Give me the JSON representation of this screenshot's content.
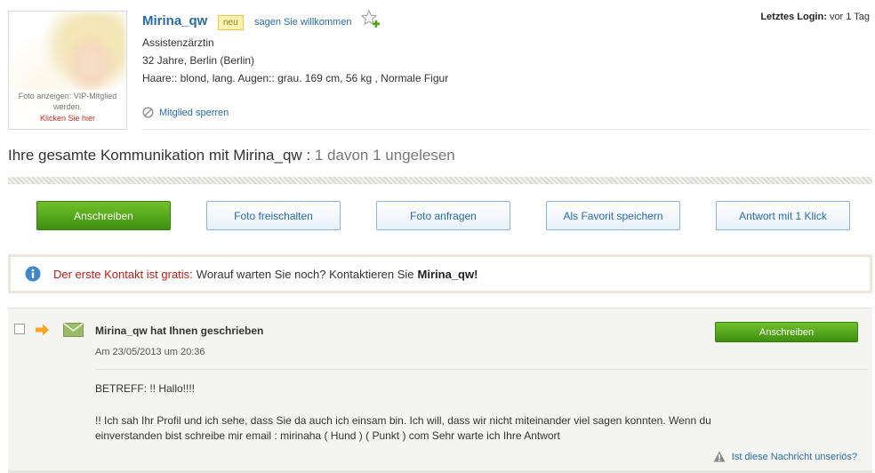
{
  "profile": {
    "photo_note": "Foto anzeigen: VIP-Mitglied werden.",
    "photo_link": "Klicken Sie hier",
    "username": "Mirina_qw",
    "badge_new": "neu",
    "welcome_link": "sagen Sie willkommen",
    "occupation": "Assistenzärztin",
    "age_location": "32 Jahre, Berlin (Berlin)",
    "appearance": "Haare:: blond, lang. Augen:: grau. 169 cm, 56 kg , Normale Figur",
    "block_member": "Mitglied sperren",
    "last_login_label": "Letztes Login:",
    "last_login_value": "vor 1 Tag"
  },
  "communication": {
    "title": "Ihre gesamte Kommunikation mit Mirina_qw :",
    "count": "1 davon 1 ungelesen"
  },
  "actions": {
    "write": "Anschreiben",
    "unlock_photo": "Foto freischalten",
    "request_photo": "Foto anfragen",
    "save_favorite": "Als Favorit speichern",
    "quick_reply": "Antwort mit 1 Klick"
  },
  "notice": {
    "red_text": "Der erste Kontakt ist gratis:",
    "text": "Worauf warten Sie noch? Kontaktieren Sie",
    "name": "Mirina_qw!"
  },
  "message": {
    "subject_title": "Mirina_qw hat Ihnen geschrieben",
    "date": "Am 23/05/2013 um 20:36",
    "reply_button": "Anschreiben",
    "betreff": "BETREFF: !! Hallo!!!!",
    "body": "!! Ich sah Ihr Profil und ich sehe, dass Sie da auch ich einsam bin. Ich will, dass wir nicht miteinander viel sagen konnten. Wenn du einverstanden bist schreibe mir email : mirinaha ( Hund ) ( Punkt ) com Sehr warte ich Ihre Antwort",
    "report_link": "Ist diese Nachricht unseriös?"
  },
  "colors": {
    "link_blue": "#2b6ca3",
    "button_green": "#4fa31c",
    "notice_red": "#b3221a"
  },
  "icons": [
    "star-plus-icon",
    "block-icon",
    "info-icon",
    "arrow-right-icon",
    "envelope-icon",
    "warning-icon"
  ]
}
